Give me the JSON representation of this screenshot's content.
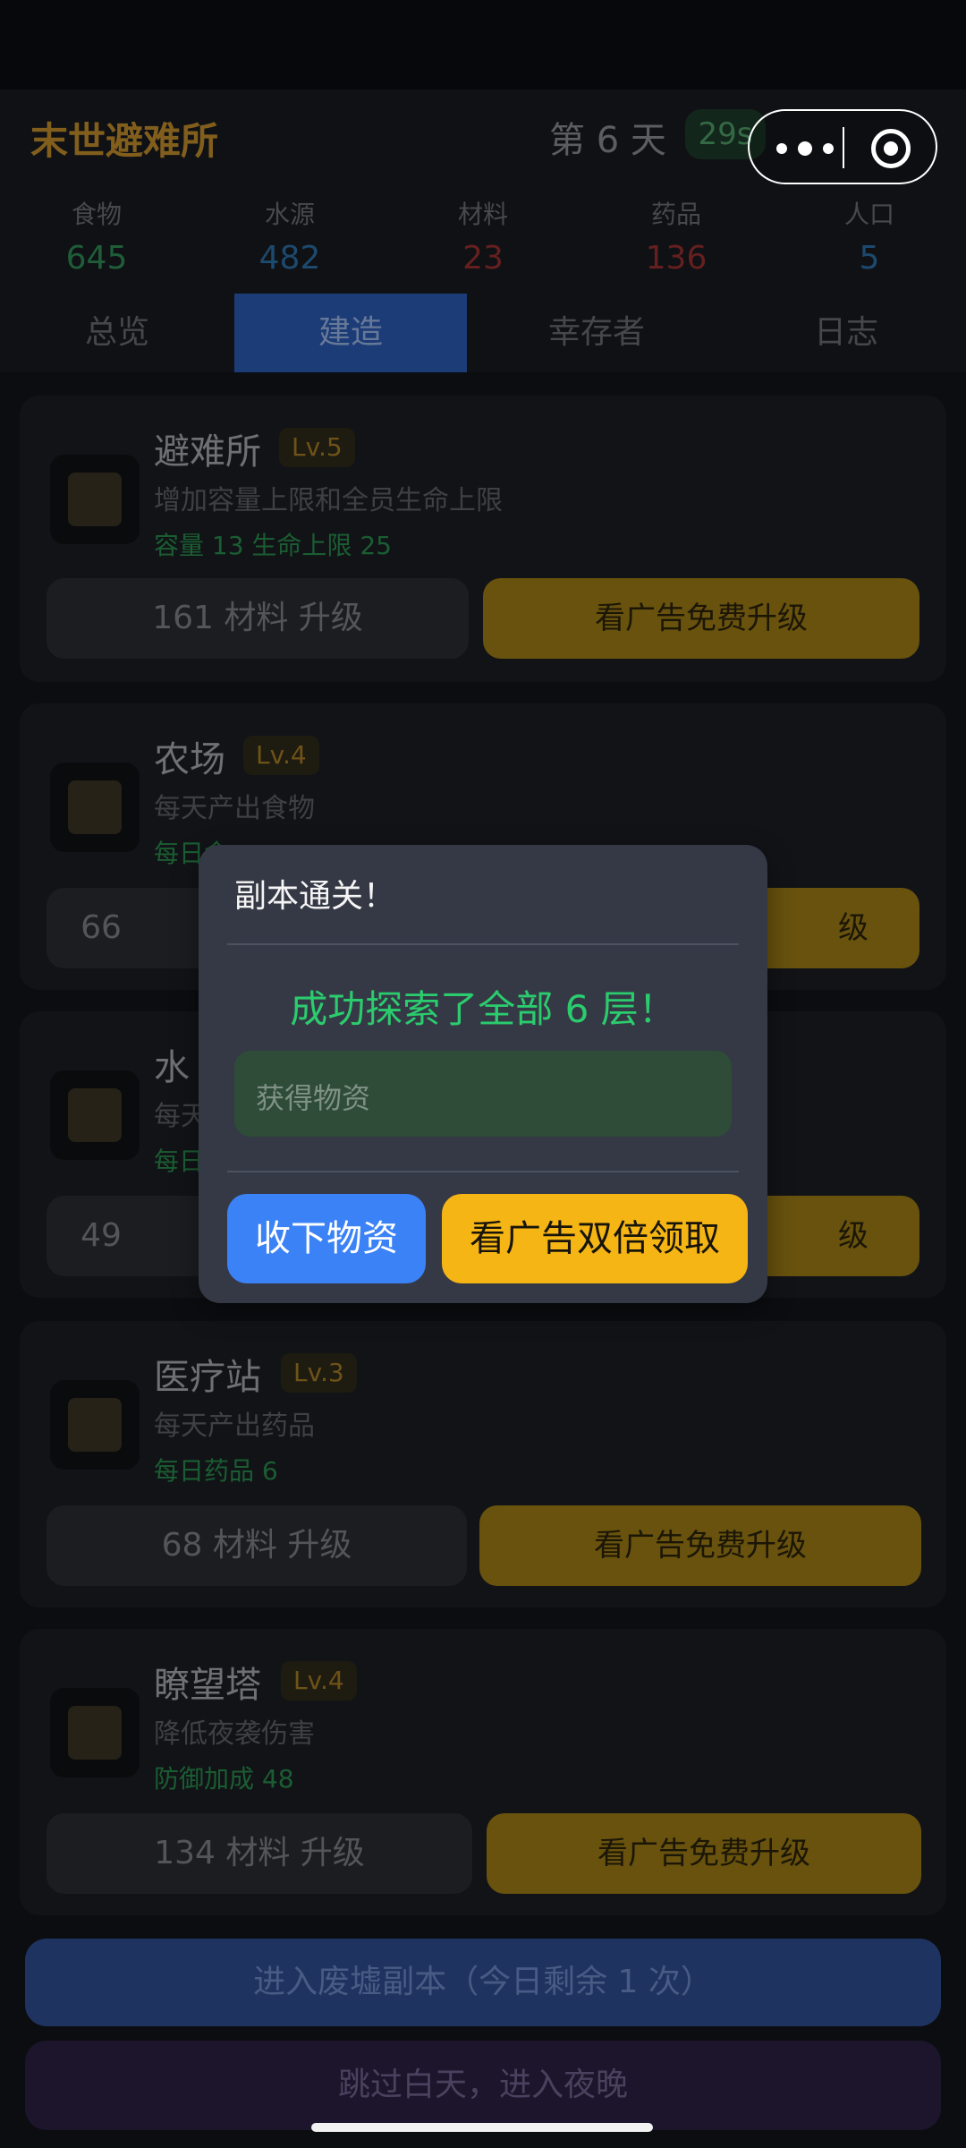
{
  "header": {
    "app_title": "末世避难所",
    "day": "第 6 天",
    "timer": "29s"
  },
  "resources": [
    {
      "label": "食物",
      "value": "645",
      "color": "#2f8e56"
    },
    {
      "label": "水源",
      "value": "482",
      "color": "#2d6fa6"
    },
    {
      "label": "材料",
      "value": "23",
      "color": "#9a2f2f"
    },
    {
      "label": "药品",
      "value": "136",
      "color": "#9a2f2f"
    },
    {
      "label": "人口",
      "value": "5",
      "color": "#2d6fa6"
    }
  ],
  "tabs": [
    "总览",
    "建造",
    "幸存者",
    "日志"
  ],
  "buildings": [
    {
      "name": "避难所",
      "level": "Lv.5",
      "desc": "增加容量上限和全员生命上限",
      "effect": "容量 13  生命上限 25",
      "upgrade": "161 材料 升级",
      "ad": "看广告免费升级"
    },
    {
      "name": "农场",
      "level": "Lv.4",
      "desc": "每天产出食物",
      "effect": "每日食",
      "upgrade": "66",
      "ad": "级"
    },
    {
      "name": "水",
      "level": "",
      "desc": "每天",
      "effect": "每日",
      "upgrade": "49",
      "ad": "级"
    },
    {
      "name": "医疗站",
      "level": "Lv.3",
      "desc": "每天产出药品",
      "effect": "每日药品 6",
      "upgrade": "68 材料 升级",
      "ad": "看广告免费升级"
    },
    {
      "name": "瞭望塔",
      "level": "Lv.4",
      "desc": "降低夜袭伤害",
      "effect": "防御加成 48",
      "upgrade": "134 材料 升级",
      "ad": "看广告免费升级"
    }
  ],
  "actions": {
    "explore": "进入废墟副本（今日剩余 1 次）",
    "night": "跳过白天，进入夜晚"
  },
  "modal": {
    "title": "副本通关！",
    "message": "成功探索了全部 6 层！",
    "loot_label": "获得物资",
    "collect": "收下物资",
    "double": "看广告双倍领取"
  }
}
